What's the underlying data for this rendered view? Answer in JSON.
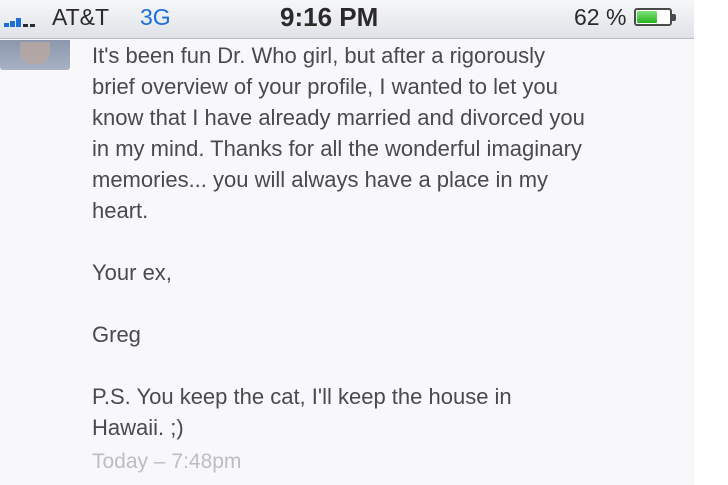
{
  "status_bar": {
    "carrier": "AT&T",
    "network": "3G",
    "time": "9:16 PM",
    "battery_percent_text": "62 %",
    "battery_level": 0.62,
    "accent_color": "#1c6fd6"
  },
  "message": {
    "body_lines": [
      "It's been fun Dr. Who girl, but after a rigorously",
      "brief overview of your profile, I wanted to let you",
      "know that I have already married and divorced you",
      "in my mind. Thanks for all the wonderful imaginary",
      "memories... you will always have a place in my",
      "heart."
    ],
    "closing": "Your ex,",
    "signature": "Greg",
    "ps_lines": [
      "P.S. You keep the cat, I'll keep the house in",
      "Hawaii. ;)"
    ],
    "timestamp": "Today – 7:48pm"
  }
}
